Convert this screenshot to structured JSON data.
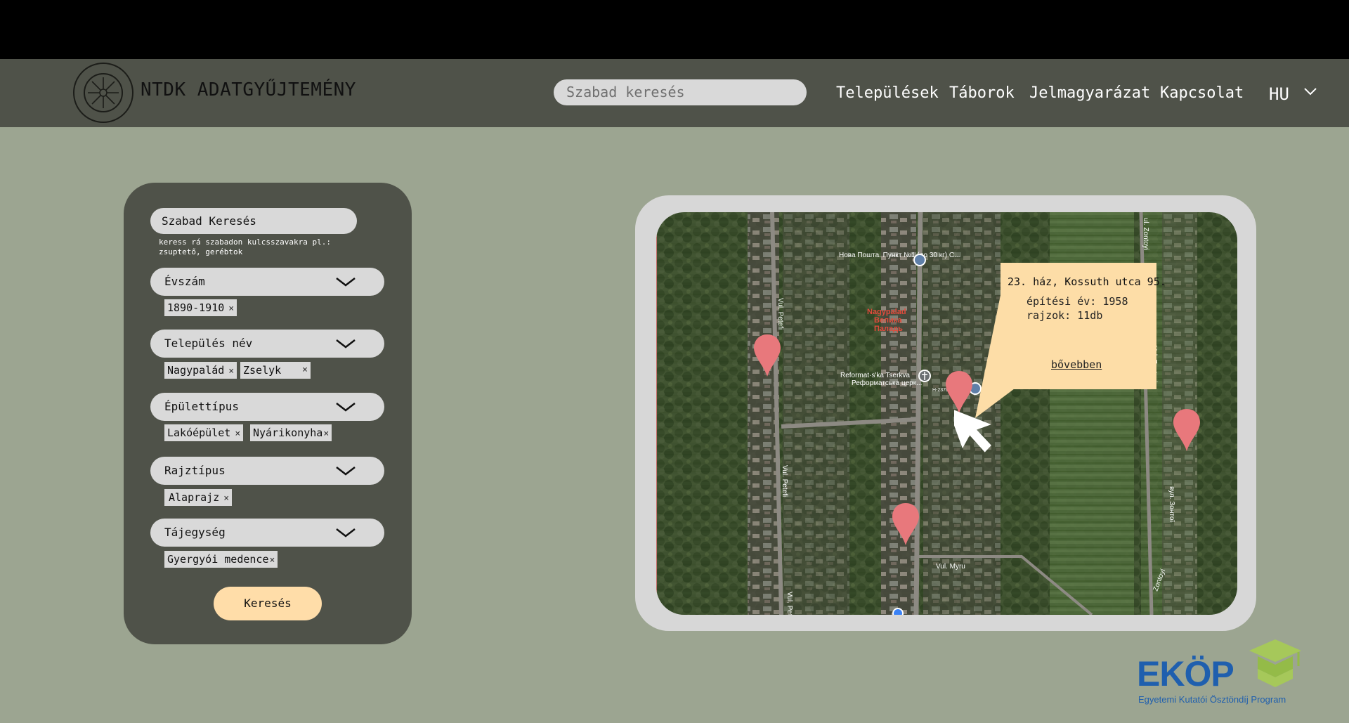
{
  "header": {
    "brand": "NTDK ADATGYŰJTEMÉNY",
    "search_placeholder": "Szabad keresés",
    "menu": [
      "Települések",
      "Táborok",
      "Jelmagyarázat",
      "Kapcsolat"
    ],
    "language": "HU"
  },
  "filters": {
    "free_search_label": "Szabad Keresés",
    "hint": "keress rá szabadon kulcsszavakra pl.: zsuptető, gerébtok",
    "facets": [
      {
        "label": "Évszám",
        "tags": [
          "1890-1910"
        ]
      },
      {
        "label": "Település név",
        "tags": [
          "Nagypalád",
          "Zselyk"
        ]
      },
      {
        "label": "Épülettípus",
        "tags": [
          "Lakóépület",
          "Nyárikonyha"
        ]
      },
      {
        "label": "Rajztípus",
        "tags": [
          "Alaprajz"
        ]
      },
      {
        "label": "Tájegység",
        "tags": [
          "Gyergyói medence"
        ]
      }
    ],
    "tag_remove_symbol": "×",
    "submit": "Keresés"
  },
  "map": {
    "labels": {
      "post_office": "Нова Пошта. Пункт №1 (до 30 кг) С...",
      "village_line1": "Nagypalad",
      "village_line2": "Велика",
      "village_line3": "Паладь",
      "church_line1": "Reformat·s'ka Tserkva",
      "church_line2": "Реформатська церк...",
      "street_petofi_1": "Vul. Petefi",
      "street_petofi_2": "Vul. Petefi",
      "street_petofi_3": "Vul. Petefi",
      "street_myru": "Vul. Myru",
      "street_zontoyi_1": "ul. Zontoyi",
      "street_zontoyi_2": "Vul. Zontoyi",
      "street_zontoyi_3": "вул. Зонтої",
      "street_zontoyi_4": "Zontoyi",
      "road_number": "H-2370"
    },
    "popup": {
      "title": "23. ház, Kossuth utca 95.",
      "year": "építési év: 1958",
      "drawings": "rajzok: 11db",
      "more": "bővebben"
    },
    "pin_color": "#e8787c",
    "popup_color": "#fddda7"
  },
  "sponsor": {
    "name": "EKÖP",
    "subtitle": "Egyetemi Kutatói Ösztöndíj Program",
    "color": "#1f5fae",
    "icon": "graduation-cap-icon"
  },
  "colors": {
    "background": "#9ca591",
    "nav": "#4f5249",
    "panel": "#4f5249",
    "button": "#ffdda9"
  }
}
